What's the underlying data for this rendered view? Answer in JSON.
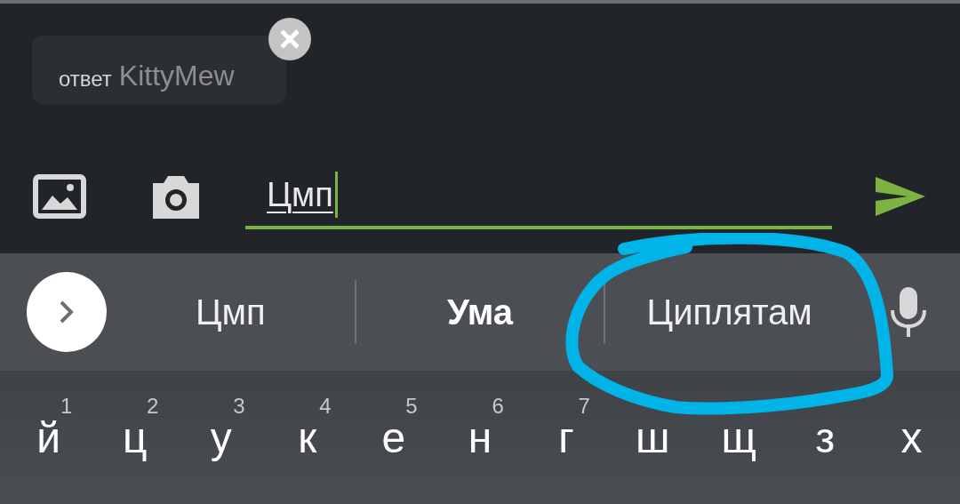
{
  "reply_chip": {
    "label": "ответ",
    "user": "KittyMew"
  },
  "message_input": {
    "value": "Цмп"
  },
  "suggestions": [
    {
      "text": "Цмп",
      "selected": false
    },
    {
      "text": "Ума",
      "selected": true
    },
    {
      "text": "Циплятам",
      "selected": false
    }
  ],
  "keys": [
    {
      "letter": "й",
      "hint": "1"
    },
    {
      "letter": "ц",
      "hint": "2"
    },
    {
      "letter": "у",
      "hint": "3"
    },
    {
      "letter": "к",
      "hint": "4"
    },
    {
      "letter": "е",
      "hint": "5"
    },
    {
      "letter": "н",
      "hint": "6"
    },
    {
      "letter": "г",
      "hint": "7"
    },
    {
      "letter": "ш"
    },
    {
      "letter": "щ"
    },
    {
      "letter": "з"
    },
    {
      "letter": "х"
    }
  ]
}
